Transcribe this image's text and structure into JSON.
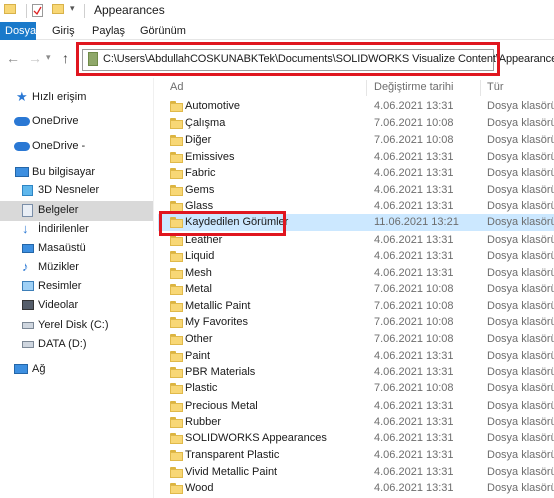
{
  "window": {
    "title": "Appearances"
  },
  "ribbon": {
    "tabs": [
      "Dosya",
      "Giriş",
      "Paylaş",
      "Görünüm"
    ]
  },
  "address": {
    "path": "C:\\Users\\AbdullahCOSKUNABKTek\\Documents\\SOLIDWORKS Visualize Content\\Appearances"
  },
  "sidebar": {
    "items": [
      {
        "label": "Hızlı erişim",
        "icon": "star-icon"
      },
      {
        "label": "OneDrive",
        "icon": "cloud-icon"
      },
      {
        "label": "OneDrive -",
        "icon": "cloud-icon"
      },
      {
        "label": "Bu bilgisayar",
        "icon": "computer-icon"
      },
      {
        "label": "3D Nesneler",
        "icon": "cube-icon"
      },
      {
        "label": "Belgeler",
        "icon": "documents-icon"
      },
      {
        "label": "İndirilenler",
        "icon": "download-icon"
      },
      {
        "label": "Masaüstü",
        "icon": "desktop-icon"
      },
      {
        "label": "Müzikler",
        "icon": "music-icon"
      },
      {
        "label": "Resimler",
        "icon": "pictures-icon"
      },
      {
        "label": "Videolar",
        "icon": "video-icon"
      },
      {
        "label": "Yerel Disk (C:)",
        "icon": "drive-icon"
      },
      {
        "label": "DATA (D:)",
        "icon": "drive-icon"
      },
      {
        "label": "Ağ",
        "icon": "network-icon"
      }
    ]
  },
  "columns": {
    "name": "Ad",
    "date": "Değiştirme tarihi",
    "type": "Tür"
  },
  "files": [
    {
      "name": "Automotive",
      "date": "4.06.2021 13:31",
      "type": "Dosya klasörü"
    },
    {
      "name": "Çalışma",
      "date": "7.06.2021 10:08",
      "type": "Dosya klasörü"
    },
    {
      "name": "Diğer",
      "date": "7.06.2021 10:08",
      "type": "Dosya klasörü"
    },
    {
      "name": "Emissives",
      "date": "4.06.2021 13:31",
      "type": "Dosya klasörü"
    },
    {
      "name": "Fabric",
      "date": "4.06.2021 13:31",
      "type": "Dosya klasörü"
    },
    {
      "name": "Gems",
      "date": "4.06.2021 13:31",
      "type": "Dosya klasörü"
    },
    {
      "name": "Glass",
      "date": "4.06.2021 13:31",
      "type": "Dosya klasörü"
    },
    {
      "name": "Kaydedilen Görümler",
      "date": "11.06.2021 13:21",
      "type": "Dosya klasörü"
    },
    {
      "name": "Leather",
      "date": "4.06.2021 13:31",
      "type": "Dosya klasörü"
    },
    {
      "name": "Liquid",
      "date": "4.06.2021 13:31",
      "type": "Dosya klasörü"
    },
    {
      "name": "Mesh",
      "date": "4.06.2021 13:31",
      "type": "Dosya klasörü"
    },
    {
      "name": "Metal",
      "date": "7.06.2021 10:08",
      "type": "Dosya klasörü"
    },
    {
      "name": "Metallic Paint",
      "date": "7.06.2021 10:08",
      "type": "Dosya klasörü"
    },
    {
      "name": "My Favorites",
      "date": "7.06.2021 10:08",
      "type": "Dosya klasörü"
    },
    {
      "name": "Other",
      "date": "7.06.2021 10:08",
      "type": "Dosya klasörü"
    },
    {
      "name": "Paint",
      "date": "4.06.2021 13:31",
      "type": "Dosya klasörü"
    },
    {
      "name": "PBR Materials",
      "date": "4.06.2021 13:31",
      "type": "Dosya klasörü"
    },
    {
      "name": "Plastic",
      "date": "7.06.2021 10:08",
      "type": "Dosya klasörü"
    },
    {
      "name": "Precious Metal",
      "date": "4.06.2021 13:31",
      "type": "Dosya klasörü"
    },
    {
      "name": "Rubber",
      "date": "4.06.2021 13:31",
      "type": "Dosya klasörü"
    },
    {
      "name": "SOLIDWORKS Appearances",
      "date": "4.06.2021 13:31",
      "type": "Dosya klasörü"
    },
    {
      "name": "Transparent Plastic",
      "date": "4.06.2021 13:31",
      "type": "Dosya klasörü"
    },
    {
      "name": "Vivid Metallic Paint",
      "date": "4.06.2021 13:31",
      "type": "Dosya klasörü"
    },
    {
      "name": "Wood",
      "date": "4.06.2021 13:31",
      "type": "Dosya klasörü"
    }
  ],
  "selected_row": "Kaydedilen Görümler",
  "selected_sidebar": "Belgeler",
  "colors": {
    "accent": "#1979ca",
    "highlight": "#e0161f",
    "selection": "#cce8ff"
  }
}
